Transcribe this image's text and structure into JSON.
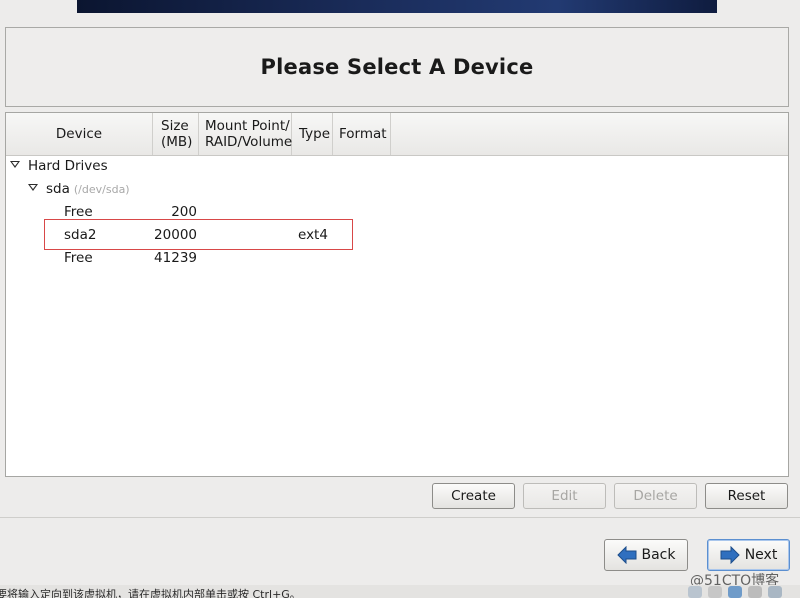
{
  "page": {
    "title": "Please Select A Device"
  },
  "table": {
    "columns": {
      "device": "Device",
      "size_line1": "Size",
      "size_line2": "(MB)",
      "mount_line1": "Mount Point/",
      "mount_line2": "RAID/Volume",
      "type": "Type",
      "format": "Format"
    },
    "group": {
      "label": "Hard Drives"
    },
    "disk": {
      "name": "sda",
      "path": "(/dev/sda)"
    },
    "rows": [
      {
        "device": "Free",
        "size": "200",
        "mount": "",
        "type": "",
        "format": ""
      },
      {
        "device": "sda2",
        "size": "20000",
        "mount": "",
        "type": "ext4",
        "format": ""
      },
      {
        "device": "Free",
        "size": "41239",
        "mount": "",
        "type": "",
        "format": ""
      }
    ]
  },
  "actions": {
    "create": "Create",
    "edit": "Edit",
    "delete": "Delete",
    "reset": "Reset"
  },
  "nav": {
    "back": "Back",
    "next": "Next"
  },
  "status": {
    "hint": "要将输入定向到该虚拟机，请在虚拟机内部单击或按 Ctrl+G。"
  },
  "watermark": "@51CTO博客",
  "colors": {
    "highlight": "#d84848",
    "banner": "#1a2c5a",
    "arrow": "#2f6fbf"
  }
}
